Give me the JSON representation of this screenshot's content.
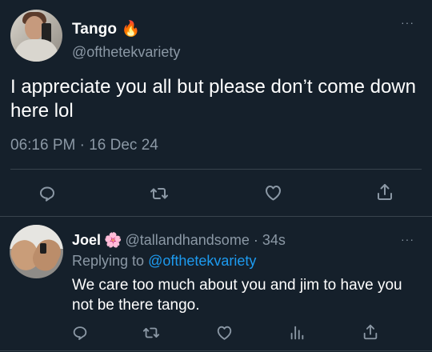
{
  "tweet": {
    "name": "Tango",
    "name_emoji": "🔥",
    "handle": "@ofthetekvariety",
    "more": "···",
    "text": "I appreciate you all but please don’t come down here lol",
    "time": "06:16 PM",
    "date_sep": " · ",
    "date": "16 Dec 24",
    "actions": [
      {
        "icon": "reply-icon"
      },
      {
        "icon": "retweet-icon"
      },
      {
        "icon": "like-icon"
      },
      {
        "icon": "share-icon"
      }
    ]
  },
  "reply": {
    "name": "Joel",
    "name_emoji": "🌸",
    "handle": "@tallandhandsome",
    "time_sep": " · ",
    "time": "34s",
    "more": "···",
    "replying_to_prefix": "Replying to ",
    "replying_to_handle": "@ofthetekvariety",
    "text": "We care too much about you and jim to have you not be there tango.",
    "actions": [
      {
        "icon": "reply-icon"
      },
      {
        "icon": "retweet-icon"
      },
      {
        "icon": "like-icon"
      },
      {
        "icon": "analytics-icon"
      },
      {
        "icon": "share-icon"
      }
    ]
  },
  "colors": {
    "background": "#15202b",
    "primary_text": "#ffffff",
    "secondary_text": "#8b98a5",
    "accent": "#1d9bf0",
    "divider": "#38444d"
  }
}
